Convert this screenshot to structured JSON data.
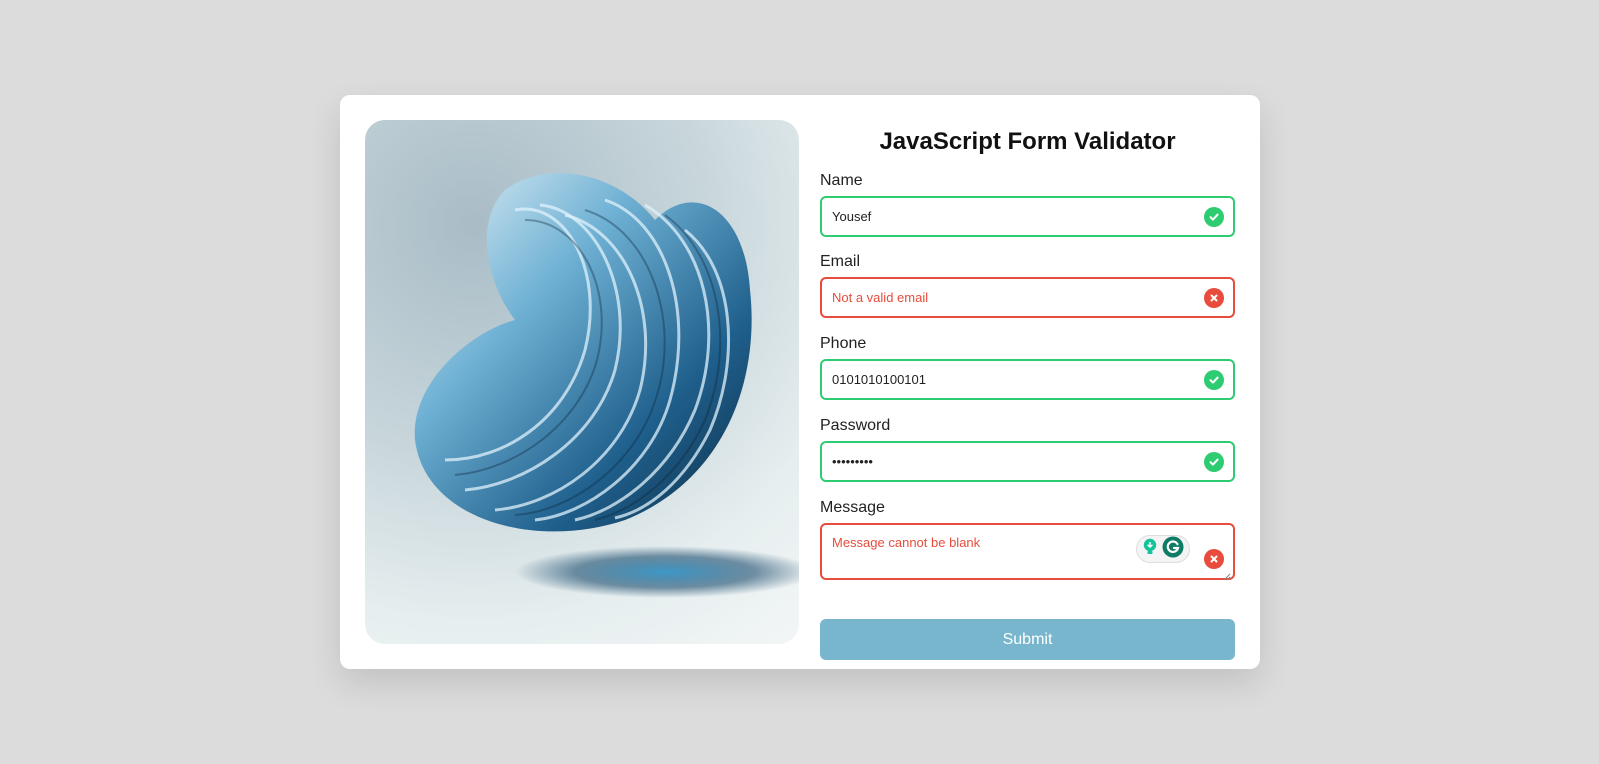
{
  "form": {
    "title": "JavaScript Form Validator",
    "fields": [
      {
        "label": "Name",
        "value": "Yousef",
        "placeholder": "",
        "status": "valid",
        "icon": "check-circle-icon"
      },
      {
        "label": "Email",
        "value": "",
        "placeholder": "Not a valid email",
        "status": "error",
        "icon": "x-circle-icon"
      },
      {
        "label": "Phone",
        "value": "0101010100101",
        "placeholder": "",
        "status": "valid",
        "icon": "check-circle-icon"
      },
      {
        "label": "Password",
        "value": "•••••••••",
        "placeholder": "",
        "status": "valid",
        "icon": "check-circle-icon"
      },
      {
        "label": "Message",
        "value": "",
        "placeholder": "Message cannot be blank",
        "status": "error",
        "icon": "x-circle-icon"
      }
    ],
    "submit_label": "Submit"
  },
  "colors": {
    "background": "#dcdcdc",
    "card": "#ffffff",
    "valid": "#2ecc71",
    "error": "#e74c3c",
    "button": "#77b6cc"
  },
  "image": {
    "icon": "abstract-swirl-art"
  },
  "extension_icons": [
    "lightbulb-icon",
    "grammarly-icon"
  ]
}
